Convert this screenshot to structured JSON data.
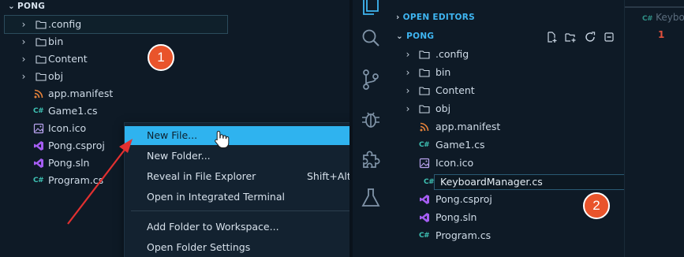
{
  "left": {
    "section_title": "PONG",
    "tree": [
      {
        "label": ".config",
        "type": "folder"
      },
      {
        "label": "bin",
        "type": "folder"
      },
      {
        "label": "Content",
        "type": "folder"
      },
      {
        "label": "obj",
        "type": "folder"
      },
      {
        "label": "app.manifest",
        "type": "rss"
      },
      {
        "label": "Game1.cs",
        "type": "csharp"
      },
      {
        "label": "Icon.ico",
        "type": "image"
      },
      {
        "label": "Pong.csproj",
        "type": "vs"
      },
      {
        "label": "Pong.sln",
        "type": "vs"
      },
      {
        "label": "Program.cs",
        "type": "csharp"
      }
    ],
    "context_menu": {
      "items": [
        {
          "label": "New File...",
          "shortcut": ""
        },
        {
          "label": "New Folder...",
          "shortcut": ""
        },
        {
          "label": "Reveal in File Explorer",
          "shortcut": "Shift+Alt+"
        },
        {
          "label": "Open in Integrated Terminal",
          "shortcut": ""
        },
        {
          "label": "Add Folder to Workspace...",
          "shortcut": ""
        },
        {
          "label": "Open Folder Settings",
          "shortcut": ""
        }
      ],
      "highlighted_item": "New File..."
    },
    "step_badge": "1"
  },
  "right": {
    "open_editors_title": "OPEN EDITORS",
    "section_title": "PONG",
    "tree": [
      {
        "label": ".config",
        "type": "folder"
      },
      {
        "label": "bin",
        "type": "folder"
      },
      {
        "label": "Content",
        "type": "folder"
      },
      {
        "label": "obj",
        "type": "folder"
      },
      {
        "label": "app.manifest",
        "type": "rss"
      },
      {
        "label": "Game1.cs",
        "type": "csharp"
      },
      {
        "label": "Icon.ico",
        "type": "image"
      },
      {
        "label": "KeyboardManager.cs",
        "type": "csharp"
      },
      {
        "label": "Pong.csproj",
        "type": "vs"
      },
      {
        "label": "Pong.sln",
        "type": "vs"
      },
      {
        "label": "Program.cs",
        "type": "csharp"
      }
    ],
    "editor_tab_label": "Keybo",
    "problem_count": "1",
    "step_badge": "2"
  },
  "colors": {
    "accent": "#2fb3ef",
    "badge": "#e9542b",
    "csharp": "#3ec2b4",
    "vs": "#a55df2",
    "rss": "#e8833a",
    "arrow": "#e23030"
  },
  "icons": {
    "activity": [
      "explorer-icon",
      "search-icon",
      "source-control-icon",
      "debug-icon",
      "extensions-icon",
      "testing-icon"
    ],
    "toolbar": [
      "new-file-icon",
      "new-folder-icon",
      "refresh-icon",
      "collapse-all-icon"
    ]
  }
}
